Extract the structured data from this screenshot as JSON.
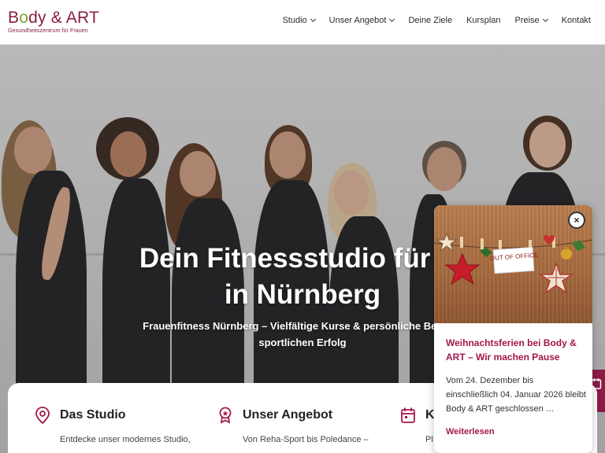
{
  "brand": {
    "logo_text_start": "B",
    "logo_text_o": "o",
    "logo_text_end": "dy & ART",
    "tagline": "Gesundheitszentrum für Frauen",
    "accent": "#8a1c46",
    "leaf_color": "#7ca531"
  },
  "nav": {
    "items": [
      {
        "label": "Studio",
        "has_dropdown": true
      },
      {
        "label": "Unser Angebot",
        "has_dropdown": true
      },
      {
        "label": "Deine Ziele",
        "has_dropdown": false
      },
      {
        "label": "Kursplan",
        "has_dropdown": false
      },
      {
        "label": "Preise",
        "has_dropdown": true
      },
      {
        "label": "Kontakt",
        "has_dropdown": false
      }
    ]
  },
  "hero": {
    "title_line1": "Dein Fitnessstudio für Fr",
    "title_line2": "in Nürnberg",
    "subtitle_line1": "Frauenfitness Nürnberg – Vielfältige Kurse & persönliche Betreuu",
    "subtitle_line2": "sportlichen Erfolg"
  },
  "cards": [
    {
      "icon": "location-pin-icon",
      "title": "Das Studio",
      "text": "Entdecke unser modernes Studio,"
    },
    {
      "icon": "award-badge-icon",
      "title": "Unser Angebot",
      "text": "Von Reha-Sport bis Poledance –"
    },
    {
      "icon": "calendar-icon",
      "title": "K",
      "text": "Pl"
    }
  ],
  "popup": {
    "image_sign": "OUT OF OFFICE",
    "title": "Weihnachtsferien bei Body & ART – Wir machen Pause",
    "text": "Vom 24. Dezember bis einschließlich 04. Januar 2026 bleibt Body & ART geschlossen …",
    "link": "Weiterlesen",
    "close": "×",
    "title_color": "#a3174d"
  }
}
